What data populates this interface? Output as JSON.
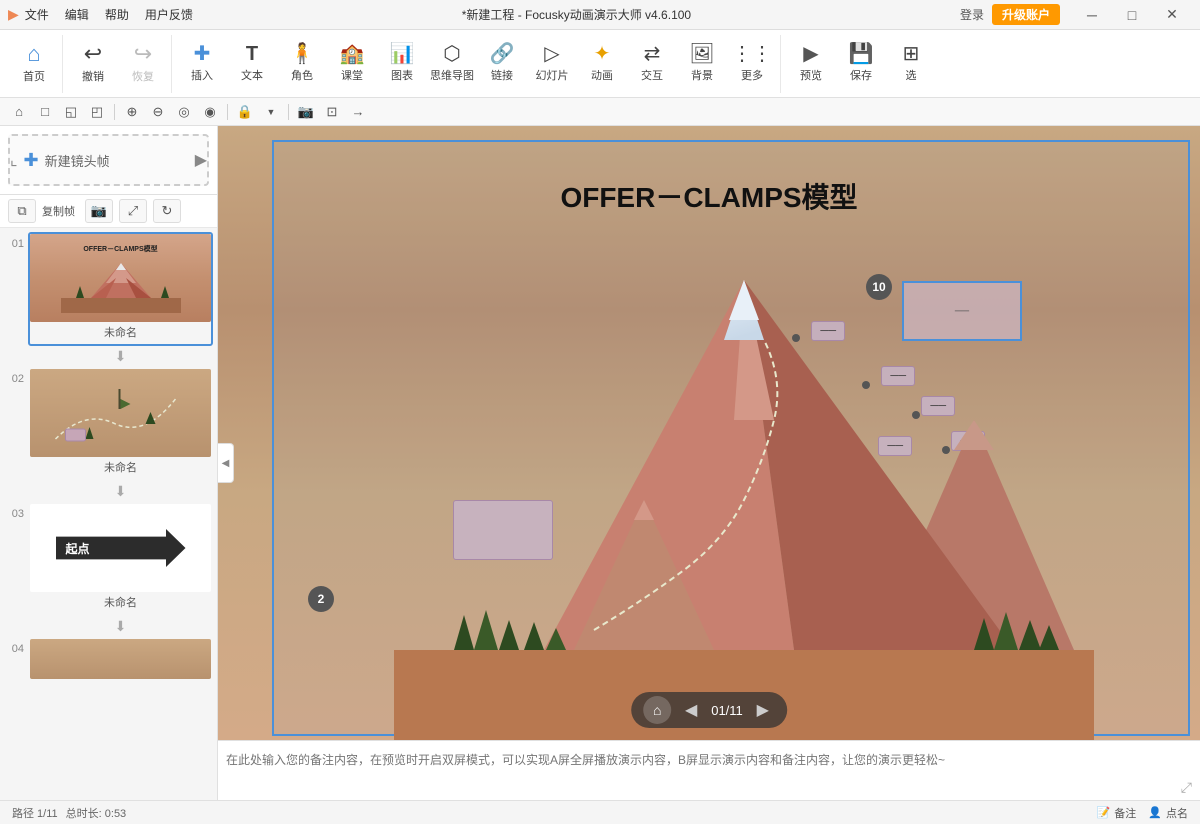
{
  "titlebar": {
    "logo": "▶",
    "menu": [
      "文件",
      "编辑",
      "帮助",
      "用户反馈"
    ],
    "title": "*新建工程 - Focusky动画演示大师 v4.6.100",
    "login": "登录",
    "upgrade": "升级账户",
    "win_min": "─",
    "win_max": "□",
    "win_close": "✕"
  },
  "toolbar": {
    "items": [
      {
        "icon": "⌂",
        "label": "首页"
      },
      {
        "icon": "↩",
        "label": "撤销"
      },
      {
        "icon": "↪",
        "label": "恢复"
      },
      {
        "icon": "＋",
        "label": "插入"
      },
      {
        "icon": "T",
        "label": "文本"
      },
      {
        "icon": "👤",
        "label": "角色"
      },
      {
        "icon": "🎓",
        "label": "课堂"
      },
      {
        "icon": "📊",
        "label": "图表"
      },
      {
        "icon": "◇",
        "label": "思维导图"
      },
      {
        "icon": "🔗",
        "label": "链接"
      },
      {
        "icon": "▷",
        "label": "幻灯片"
      },
      {
        "icon": "✦",
        "label": "动画"
      },
      {
        "icon": "⇄",
        "label": "交互"
      },
      {
        "icon": "🖼",
        "label": "背景"
      },
      {
        "icon": "⋯",
        "label": "更多"
      },
      {
        "icon": "▶",
        "label": "预览"
      },
      {
        "icon": "💾",
        "label": "保存"
      },
      {
        "icon": "⊞",
        "label": "选"
      }
    ]
  },
  "toolbar2": {
    "tools": [
      "⌂",
      "□",
      "◱",
      "◰",
      "⊕",
      "⊖",
      "◎",
      "◉",
      "║",
      "⊟",
      "⊠",
      "📷",
      "⊡",
      "→"
    ]
  },
  "sidebar": {
    "new_frame_label": "新建镜头帧",
    "copy_label": "复制帧",
    "slides": [
      {
        "num": "01",
        "name": "未命名",
        "active": true
      },
      {
        "num": "02",
        "name": "未命名",
        "active": false
      },
      {
        "num": "03",
        "name": "未命名",
        "active": false
      },
      {
        "num": "04",
        "name": "",
        "active": false
      }
    ]
  },
  "canvas": {
    "title": "OFFER－CLAMPS模型",
    "selected_box_label": "",
    "num_badge_1": "10",
    "num_badge_2": "2",
    "nav_page": "01/11"
  },
  "notes": {
    "placeholder": "在此处输入您的备注内容，在预览时开启双屏模式，可以实现A屏全屏播放演示内容，B屏显示演示内容和备注内容，让您的演示更轻松~"
  },
  "statusbar": {
    "path": "路径 1/11",
    "duration": "总时长: 0:53",
    "comment_label": "备注",
    "signin_label": "点名"
  }
}
